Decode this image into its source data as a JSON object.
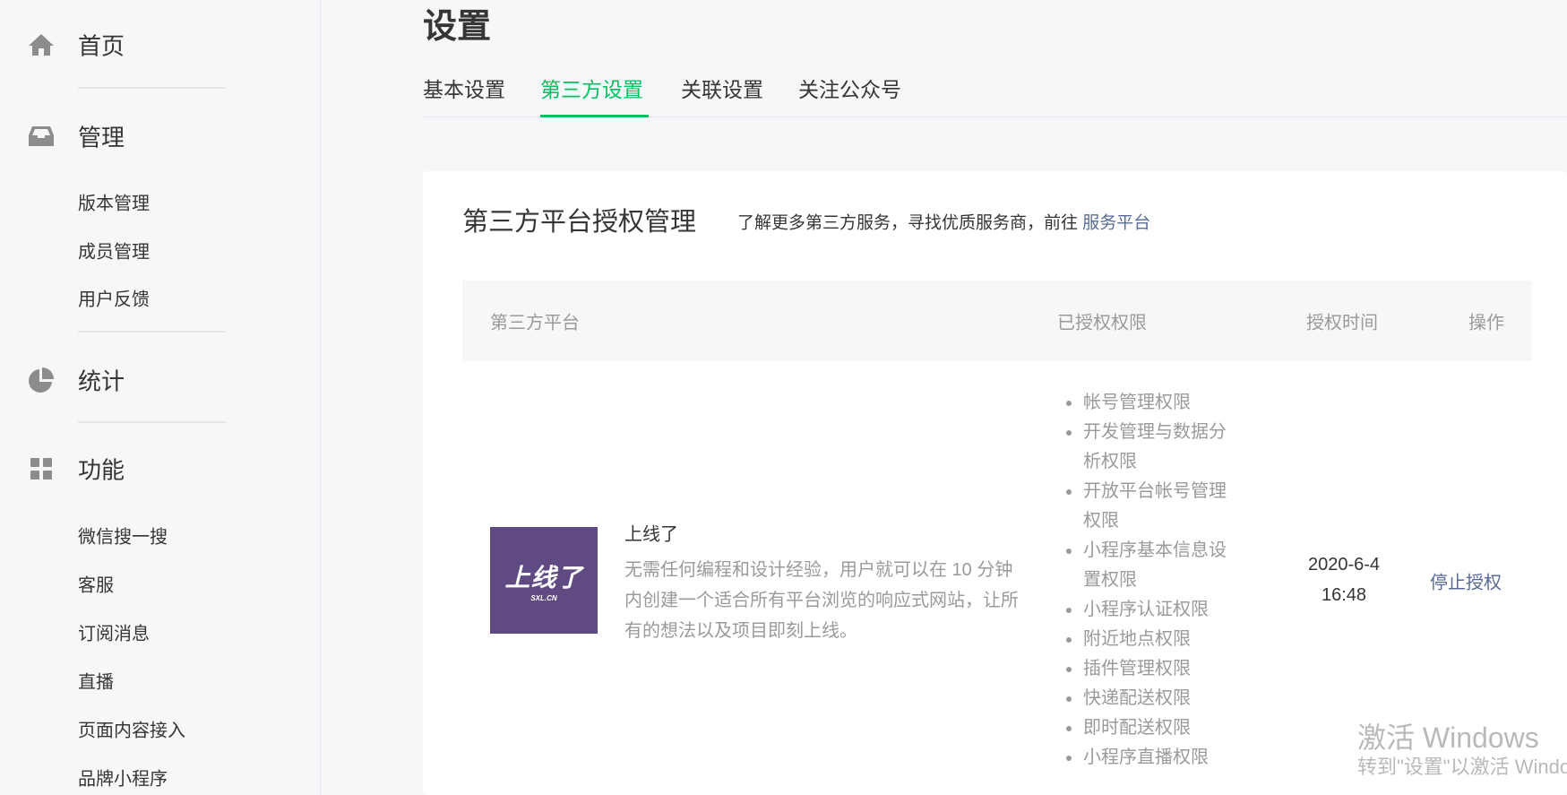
{
  "sidebar": {
    "home": "首页",
    "manage": {
      "label": "管理",
      "items": [
        "版本管理",
        "成员管理",
        "用户反馈"
      ]
    },
    "stats": "统计",
    "features": {
      "label": "功能",
      "items": [
        "微信搜一搜",
        "客服",
        "订阅消息",
        "直播",
        "页面内容接入",
        "品牌小程序"
      ]
    }
  },
  "page": {
    "title": "设置"
  },
  "tabs": [
    "基本设置",
    "第三方设置",
    "关联设置",
    "关注公众号"
  ],
  "active_tab": "第三方设置",
  "card": {
    "title": "第三方平台授权管理",
    "subtitle": "了解更多第三方服务，寻找优质服务商，前往",
    "link": "服务平台"
  },
  "table": {
    "headers": [
      "第三方平台",
      "已授权权限",
      "授权时间",
      "操作"
    ],
    "rows": [
      {
        "logo_text": "上线了",
        "logo_sub": "SXL.CN",
        "name": "上线了",
        "description": "无需任何编程和设计经验，用户就可以在 10 分钟内创建一个适合所有平台浏览的响应式网站，让所有的想法以及项目即刻上线。",
        "permissions": [
          "帐号管理权限",
          "开发管理与数据分析权限",
          "开放平台帐号管理权限",
          "小程序基本信息设置权限",
          "小程序认证权限",
          "附近地点权限",
          "插件管理权限",
          "快递配送权限",
          "即时配送权限",
          "小程序直播权限"
        ],
        "date": "2020-6-4",
        "time": "16:48",
        "action": "停止授权"
      }
    ]
  },
  "watermark": {
    "line1": "激活 Windows",
    "line2": "转到\"设置\"以激活 Windows。"
  },
  "colors": {
    "accent": "#07c160",
    "link": "#576b95",
    "logo_bg": "#5f4b82"
  }
}
